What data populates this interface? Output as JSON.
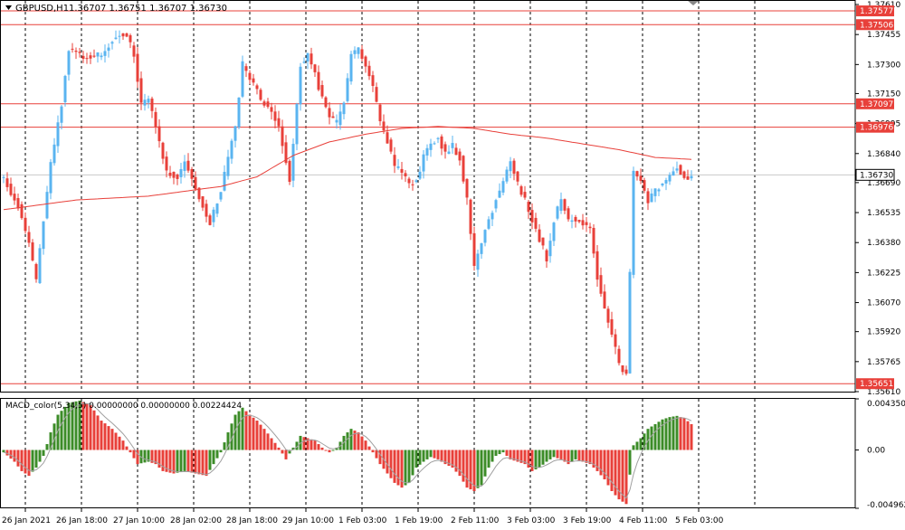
{
  "header": {
    "symbol": "GBPUSD,H1",
    "ohlc": "1.36707 1.36751 1.36707 1.36730",
    "macd_label": "MACD_color(5,34,5) 0.00000000 0.00000000 0.00224424"
  },
  "colors": {
    "bull": "#5ab4f0",
    "bear": "#e8403a",
    "ma": "#e8403a",
    "hline": "#e8403a",
    "macd_pos": "#3c8c28",
    "macd_neg": "#e8403a",
    "signal": "#a0a0a0",
    "grid": "#000000",
    "current_price": "#c8c8c8"
  },
  "chart_data": [
    {
      "type": "candlestick",
      "y_ticks": [
        "1.37610",
        "1.37455",
        "1.37300",
        "1.37150",
        "1.36995",
        "1.36840",
        "1.36690",
        "1.36535",
        "1.36380",
        "1.36225",
        "1.36070",
        "1.35920",
        "1.35765",
        "1.35610"
      ],
      "ylim": [
        1.3561,
        1.3761
      ],
      "x_ticks": [
        "26 Jan 2021",
        "26 Jan 18:00",
        "27 Jan 10:00",
        "28 Jan 02:00",
        "28 Jan 18:00",
        "29 Jan 10:00",
        "1 Feb 03:00",
        "1 Feb 19:00",
        "2 Feb 11:00",
        "3 Feb 03:00",
        "3 Feb 19:00",
        "4 Feb 11:00",
        "5 Feb 03:00"
      ],
      "horizontal_lines": [
        {
          "label": "1.37577",
          "value": 1.37577
        },
        {
          "label": "1.37506",
          "value": 1.37506
        },
        {
          "label": "1.37097",
          "value": 1.37097
        },
        {
          "label": "1.36976",
          "value": 1.36976
        },
        {
          "label": "1.35651",
          "value": 1.35651
        }
      ],
      "current_price": {
        "label": "1.36730",
        "value": 1.3673
      },
      "anchors": [
        [
          0,
          1.3671
        ],
        [
          4,
          1.3657
        ],
        [
          7,
          1.3637
        ],
        [
          9,
          1.3618
        ],
        [
          11,
          1.365
        ],
        [
          13,
          1.3678
        ],
        [
          16,
          1.371
        ],
        [
          18,
          1.3738
        ],
        [
          22,
          1.3734
        ],
        [
          27,
          1.3735
        ],
        [
          31,
          1.3745
        ],
        [
          34,
          1.3745
        ],
        [
          36,
          1.3735
        ],
        [
          38,
          1.371
        ],
        [
          40,
          1.3712
        ],
        [
          42,
          1.3698
        ],
        [
          45,
          1.3675
        ],
        [
          48,
          1.3672
        ],
        [
          50,
          1.368
        ],
        [
          54,
          1.3662
        ],
        [
          57,
          1.3648
        ],
        [
          60,
          1.3665
        ],
        [
          64,
          1.3698
        ],
        [
          66,
          1.373
        ],
        [
          69,
          1.372
        ],
        [
          71,
          1.3712
        ],
        [
          74,
          1.3705
        ],
        [
          76,
          1.3698
        ],
        [
          79,
          1.367
        ],
        [
          82,
          1.373
        ],
        [
          84,
          1.3735
        ],
        [
          86,
          1.3725
        ],
        [
          88,
          1.3712
        ],
        [
          90,
          1.3702
        ],
        [
          92,
          1.37
        ],
        [
          94,
          1.371
        ],
        [
          96,
          1.3735
        ],
        [
          98,
          1.3738
        ],
        [
          100,
          1.373
        ],
        [
          102,
          1.3718
        ],
        [
          104,
          1.37
        ],
        [
          106,
          1.369
        ],
        [
          108,
          1.3677
        ],
        [
          110,
          1.3675
        ],
        [
          112,
          1.3667
        ],
        [
          114,
          1.367
        ],
        [
          116,
          1.3682
        ],
        [
          118,
          1.369
        ],
        [
          120,
          1.3692
        ],
        [
          122,
          1.3684
        ],
        [
          124,
          1.3688
        ],
        [
          126,
          1.3682
        ],
        [
          128,
          1.366
        ],
        [
          130,
          1.3625
        ],
        [
          132,
          1.3638
        ],
        [
          134,
          1.365
        ],
        [
          136,
          1.366
        ],
        [
          138,
          1.367
        ],
        [
          140,
          1.368
        ],
        [
          142,
          1.3668
        ],
        [
          144,
          1.366
        ],
        [
          146,
          1.365
        ],
        [
          148,
          1.364
        ],
        [
          150,
          1.363
        ],
        [
          152,
          1.365
        ],
        [
          154,
          1.366
        ],
        [
          156,
          1.365
        ],
        [
          158,
          1.365
        ],
        [
          160,
          1.3648
        ],
        [
          162,
          1.3645
        ],
        [
          164,
          1.362
        ],
        [
          166,
          1.3605
        ],
        [
          168,
          1.359
        ],
        [
          170,
          1.3575
        ],
        [
          172,
          1.357
        ],
        [
          174,
          1.3675
        ],
        [
          176,
          1.367
        ],
        [
          178,
          1.366
        ],
        [
          180,
          1.3665
        ],
        [
          182,
          1.3668
        ],
        [
          184,
          1.3672
        ],
        [
          186,
          1.3678
        ],
        [
          188,
          1.3671
        ],
        [
          190,
          1.3673
        ]
      ],
      "moving_average": [
        [
          0,
          1.3655
        ],
        [
          20,
          1.366
        ],
        [
          40,
          1.3662
        ],
        [
          60,
          1.3667
        ],
        [
          70,
          1.3672
        ],
        [
          80,
          1.3683
        ],
        [
          90,
          1.369
        ],
        [
          100,
          1.3694
        ],
        [
          110,
          1.3697
        ],
        [
          120,
          1.3698
        ],
        [
          130,
          1.3697
        ],
        [
          140,
          1.3694
        ],
        [
          150,
          1.3692
        ],
        [
          160,
          1.3689
        ],
        [
          170,
          1.3686
        ],
        [
          180,
          1.3682
        ],
        [
          190,
          1.3681
        ]
      ]
    },
    {
      "type": "bar",
      "name": "MACD_color(5,34,5)",
      "y_ticks": [
        "0.0043504",
        "0.00",
        "-0.0049627"
      ],
      "ylim": [
        -0.0049627,
        0.0043504
      ],
      "anchors": [
        [
          0,
          -0.0002
        ],
        [
          3,
          -0.001
        ],
        [
          5,
          -0.0018
        ],
        [
          7,
          -0.0022
        ],
        [
          9,
          -0.0015
        ],
        [
          11,
          -0.0005
        ],
        [
          13,
          0.0015
        ],
        [
          15,
          0.003
        ],
        [
          18,
          0.004
        ],
        [
          21,
          0.0042
        ],
        [
          24,
          0.0038
        ],
        [
          27,
          0.0025
        ],
        [
          30,
          0.0018
        ],
        [
          33,
          0.0008
        ],
        [
          35,
          -0.0002
        ],
        [
          37,
          -0.0012
        ],
        [
          40,
          -0.001
        ],
        [
          42,
          -0.0012
        ],
        [
          44,
          -0.0018
        ],
        [
          47,
          -0.002
        ],
        [
          50,
          -0.0018
        ],
        [
          53,
          -0.002
        ],
        [
          56,
          -0.0022
        ],
        [
          58,
          -0.0012
        ],
        [
          60,
          -0.0002
        ],
        [
          62,
          0.0015
        ],
        [
          64,
          0.003
        ],
        [
          66,
          0.0036
        ],
        [
          68,
          0.003
        ],
        [
          70,
          0.0025
        ],
        [
          72,
          0.0018
        ],
        [
          74,
          0.001
        ],
        [
          76,
          0.0002
        ],
        [
          78,
          -0.0008
        ],
        [
          80,
          0.0002
        ],
        [
          82,
          0.0012
        ],
        [
          84,
          0.001
        ],
        [
          86,
          0.0008
        ],
        [
          88,
          0.0002
        ],
        [
          90,
          -0.0002
        ],
        [
          92,
          0.0002
        ],
        [
          94,
          0.0012
        ],
        [
          96,
          0.0018
        ],
        [
          98,
          0.0015
        ],
        [
          100,
          0.0008
        ],
        [
          102,
          -0.0002
        ],
        [
          104,
          -0.0012
        ],
        [
          106,
          -0.002
        ],
        [
          108,
          -0.0028
        ],
        [
          110,
          -0.0032
        ],
        [
          112,
          -0.0028
        ],
        [
          114,
          -0.0015
        ],
        [
          116,
          -0.001
        ],
        [
          118,
          -0.0006
        ],
        [
          120,
          -0.0008
        ],
        [
          122,
          -0.0012
        ],
        [
          124,
          -0.0015
        ],
        [
          126,
          -0.0022
        ],
        [
          128,
          -0.0032
        ],
        [
          130,
          -0.0035
        ],
        [
          132,
          -0.003
        ],
        [
          134,
          -0.0015
        ],
        [
          136,
          -0.0005
        ],
        [
          138,
          -0.0002
        ],
        [
          140,
          -0.0008
        ],
        [
          142,
          -0.001
        ],
        [
          144,
          -0.0012
        ],
        [
          146,
          -0.0018
        ],
        [
          148,
          -0.0015
        ],
        [
          150,
          -0.001
        ],
        [
          152,
          -0.0006
        ],
        [
          154,
          -0.0008
        ],
        [
          156,
          -0.0012
        ],
        [
          158,
          -0.0008
        ],
        [
          160,
          -0.001
        ],
        [
          162,
          -0.0012
        ],
        [
          164,
          -0.0018
        ],
        [
          166,
          -0.0025
        ],
        [
          168,
          -0.0035
        ],
        [
          170,
          -0.0042
        ],
        [
          172,
          -0.0046
        ],
        [
          174,
          0.0004
        ],
        [
          176,
          0.001
        ],
        [
          178,
          0.0018
        ],
        [
          180,
          0.0022
        ],
        [
          182,
          0.0026
        ],
        [
          184,
          0.0028
        ],
        [
          186,
          0.0029
        ],
        [
          188,
          0.0027
        ],
        [
          190,
          0.0022
        ]
      ]
    }
  ]
}
